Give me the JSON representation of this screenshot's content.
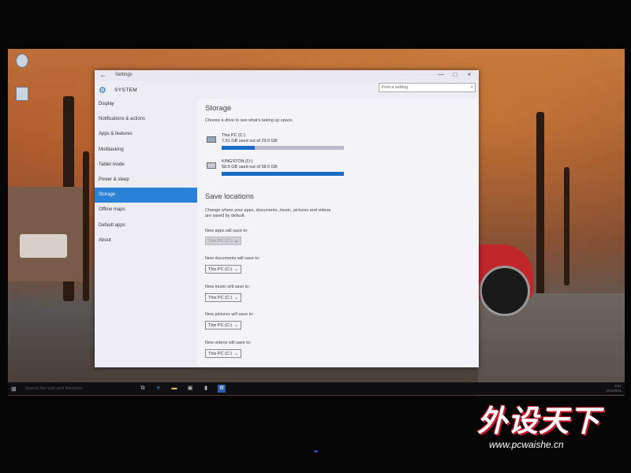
{
  "window": {
    "title": "Settings",
    "search_placeholder": "Find a setting",
    "section_title": "SYSTEM",
    "controls": [
      "—",
      "□",
      "×"
    ]
  },
  "sidebar": {
    "items": [
      {
        "label": "Display",
        "active": false
      },
      {
        "label": "Notifications & actions",
        "active": false
      },
      {
        "label": "Apps & features",
        "active": false
      },
      {
        "label": "Multitasking",
        "active": false
      },
      {
        "label": "Tablet mode",
        "active": false
      },
      {
        "label": "Power & sleep",
        "active": false
      },
      {
        "label": "Storage",
        "active": true
      },
      {
        "label": "Offline maps",
        "active": false
      },
      {
        "label": "Default apps",
        "active": false
      },
      {
        "label": "About",
        "active": false
      }
    ]
  },
  "storage": {
    "heading": "Storage",
    "description": "Choose a drive to see what's taking up space.",
    "drives": [
      {
        "name": "This PC (C:)",
        "usage": "7.91 GB used out of 29.0 GB",
        "fraction": 0.27
      },
      {
        "name": "KINGSTON (D:)",
        "usage": "58.5 GB used out of 58.5 GB",
        "fraction": 1.0
      }
    ]
  },
  "save_locations": {
    "heading": "Save locations",
    "description_line1": "Change where your apps, documents, music, pictures and videos",
    "description_line2": "are saved by default.",
    "fields": [
      {
        "label": "New apps will save to:",
        "value": "This PC (C:)",
        "disabled": true
      },
      {
        "label": "New documents will save to:",
        "value": "This PC (C:)",
        "disabled": false
      },
      {
        "label": "New music will save to:",
        "value": "This PC (C:)",
        "disabled": false
      },
      {
        "label": "New pictures will save to:",
        "value": "This PC (C:)",
        "disabled": false
      },
      {
        "label": "New videos will save to:",
        "value": "This PC (C:)",
        "disabled": false
      }
    ]
  },
  "taskbar": {
    "search_text": "Search the web and Windows",
    "icons": [
      "task-view-icon",
      "edge-icon",
      "file-explorer-icon",
      "store-icon",
      "bookmark-icon",
      "settings-app-icon"
    ],
    "tray_line1": "8:51",
    "tray_line2": "2015/8/11"
  },
  "watermark": {
    "brand": "外设天下",
    "url": "www.pcwaishe.cn"
  },
  "colors": {
    "accent": "#2a82d6",
    "bar_fill": "#1c6ac8",
    "watermark_red": "#c8182a"
  }
}
